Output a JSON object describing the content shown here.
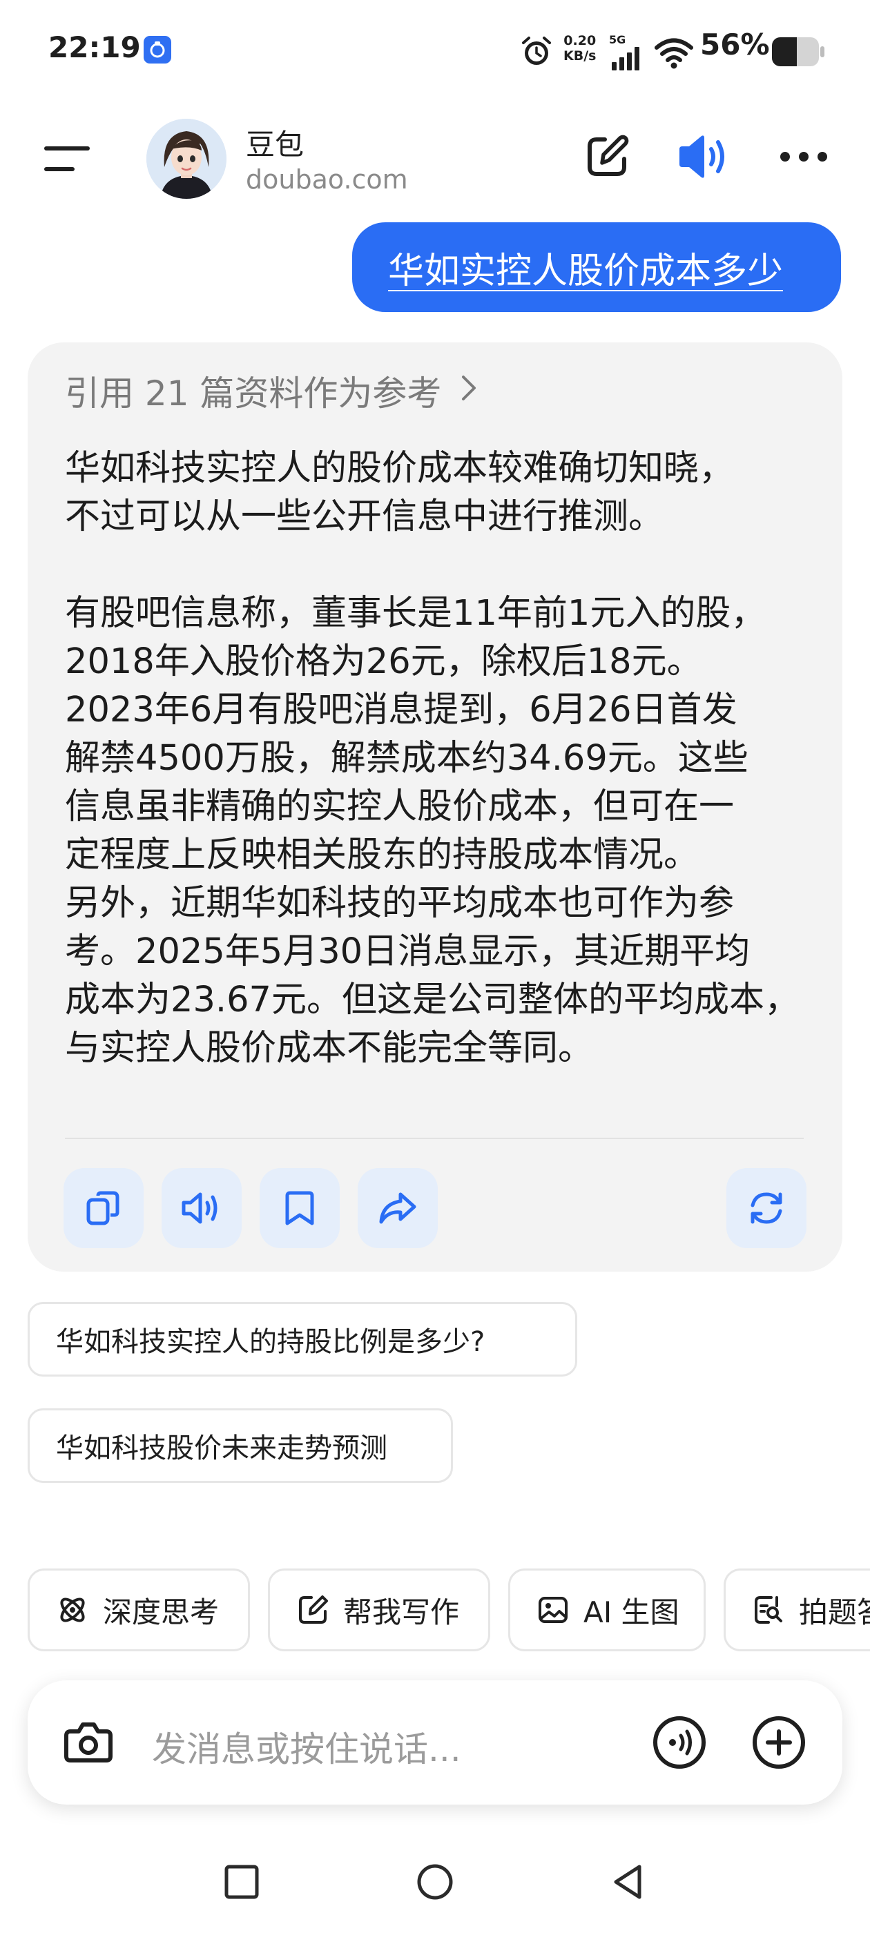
{
  "status_bar": {
    "time": "22:19",
    "net_speed_value": "0.20",
    "net_speed_unit": "KB/s",
    "network": "5G",
    "battery": "56%"
  },
  "header": {
    "bot_name": "豆包",
    "bot_domain": "doubao.com",
    "icons": [
      "menu-icon",
      "edit-icon",
      "speaker-icon",
      "more-icon"
    ]
  },
  "user_message": "华如实控人股价成本多少",
  "answer": {
    "reference_label": "引用 21 篇资料作为参考",
    "paragraphs": [
      "华如科技实控人的股价成本较难确切知晓，\n不过可以从一些公开信息中进行推测。",
      "有股吧信息称，董事长是11年前1元入的股，\n2018年入股价格为26元，除权后18元。\n2023年6月有股吧消息提到，6月26日首发\n解禁4500万股，解禁成本约34.69元。这些\n信息虽非精确的实控人股价成本，但可在一\n定程度上反映相关股东的持股成本情况。",
      "另外，近期华如科技的平均成本也可作为参\n考。2025年5月30日消息显示，其近期平均\n成本为23.67元。但这是公司整体的平均成本，\n与实控人股价成本不能完全等同。"
    ],
    "actions": [
      "copy-icon",
      "read-aloud-icon",
      "bookmark-icon",
      "share-icon",
      "regenerate-icon"
    ]
  },
  "suggestions": [
    "华如科技实控人的持股比例是多少?",
    "华如科技股价未来走势预测"
  ],
  "tools": [
    {
      "label": "深度思考",
      "icon": "atom-icon"
    },
    {
      "label": "帮我写作",
      "icon": "pen-icon"
    },
    {
      "label": "AI 生图",
      "icon": "image-icon"
    },
    {
      "label": "拍题答",
      "icon": "scan-icon"
    }
  ],
  "input": {
    "placeholder": "发消息或按住说话..."
  },
  "colors": {
    "accent": "#2a6df4",
    "card_bg": "#f3f3f3",
    "action_bg": "#e5eefb"
  }
}
